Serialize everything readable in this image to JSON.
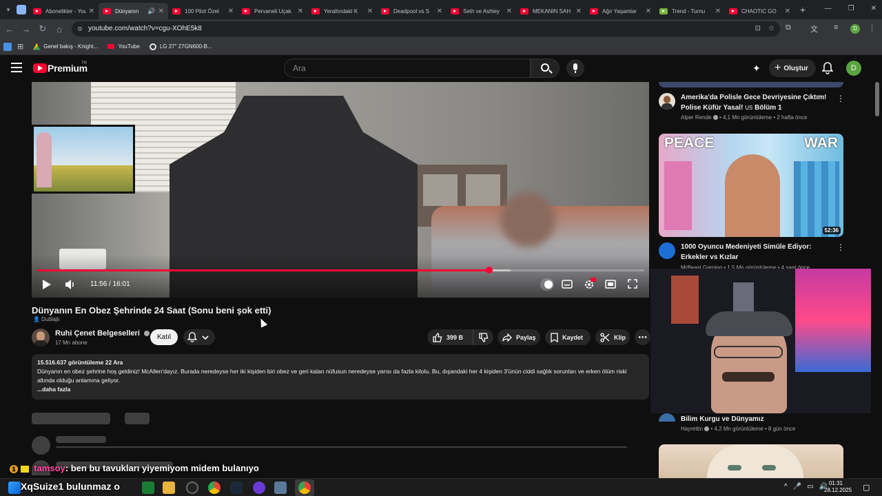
{
  "browser": {
    "tabs": [
      {
        "label": "Abonelikler - YouTube",
        "active": false
      },
      {
        "label": "Dünyanın",
        "active": true
      },
      {
        "label": "100 Pilot Özel",
        "active": false
      },
      {
        "label": "Pervaneli Uçak",
        "active": false
      },
      {
        "label": "Yeraltındaki K",
        "active": false
      },
      {
        "label": "Deadpool vs S",
        "active": false
      },
      {
        "label": "Seth ve Ashley",
        "active": false
      },
      {
        "label": "MEKANIN SAH",
        "active": false
      },
      {
        "label": "Ağır Yaşamlar",
        "active": false
      },
      {
        "label": "Trend - Turnu",
        "active": false
      },
      {
        "label": "CHAOTIC GO",
        "active": false
      }
    ],
    "url": "youtube.com/watch?v=cgu-XOhE5k8",
    "bookmarks": [
      "Genel bakış - Knight...",
      "YouTube",
      "LG 27\" 27GN600-B..."
    ],
    "profile_initial": "D"
  },
  "youtube": {
    "logo_text": "Premium",
    "logo_region": "TR",
    "search_placeholder": "Ara",
    "create_label": "Oluştur",
    "avatar_initial": "D"
  },
  "player": {
    "time": "11:56 / 16:01",
    "progress_fraction": 0.745,
    "buffer_fraction": 0.78
  },
  "video": {
    "title": "Dünyanın En Obez Şehrinde 24 Saat (Sonu beni şok etti)",
    "dubbed_label": "Dublajlı",
    "channel_name": "Ruhi Çenet Belgeselleri",
    "subscribers": "17 Mn abone",
    "join_label": "Katıl",
    "like_count": "399 B",
    "share_label": "Paylaş",
    "save_label": "Kaydet",
    "clip_label": "Klip",
    "views_date": "15.516.637 görüntüleme  22 Ara",
    "description": "Dünyanın en obez şehrine hoş geldiniz! McAllen'dayız. Burada neredeyse her iki kişiden biri obez ve geri kalan nüfusun neredeyse yarısı da fazla kilolu. Bu, dışandaki her 4 kişiden 3'ünün ciddi sağlık sorunları ve erken ölüm riski altında olduğu anlamına geliyor.",
    "more_label": "...daha fazla"
  },
  "chat": {
    "user": "tamsoy",
    "message": ": ben bu tavukları yiyemiyom midem bulanıyo",
    "badge": "1"
  },
  "taskbar_overlay": {
    "text": "XqSuize1 bulunmaz o"
  },
  "sidebar": {
    "items": [
      {
        "title": "Amerika'da Polisle Gece Devriyesine Çıktım! Polise Küfür Yasal! ",
        "title_suffix": "US",
        "title_end": " Bölüm 1",
        "channel": "Alper Rende",
        "meta": "4,1 Mn görüntüleme • 2 hafta önce"
      },
      {
        "title": "1000 Oyuncu Medeniyeti Simüle Ediyor: Erkekler vs Kızlar",
        "channel": "MrBeast Gaming",
        "meta": "1,5 Mn görüntüleme • 4 saat önce",
        "duration": "52:36",
        "thumb_left": "PEACE",
        "thumb_right": "WAR"
      },
      {
        "title": "Bilim Kurgu ve Dünyamız",
        "channel": "Hayrettin",
        "meta": "4,2 Mn görüntüleme • 8 gün önce"
      }
    ]
  },
  "clock": {
    "time": "01:31",
    "date": "28.12.2025"
  },
  "colors": {
    "accent": "#ff0033",
    "bg": "#0f0f0f",
    "surface": "#272727"
  }
}
